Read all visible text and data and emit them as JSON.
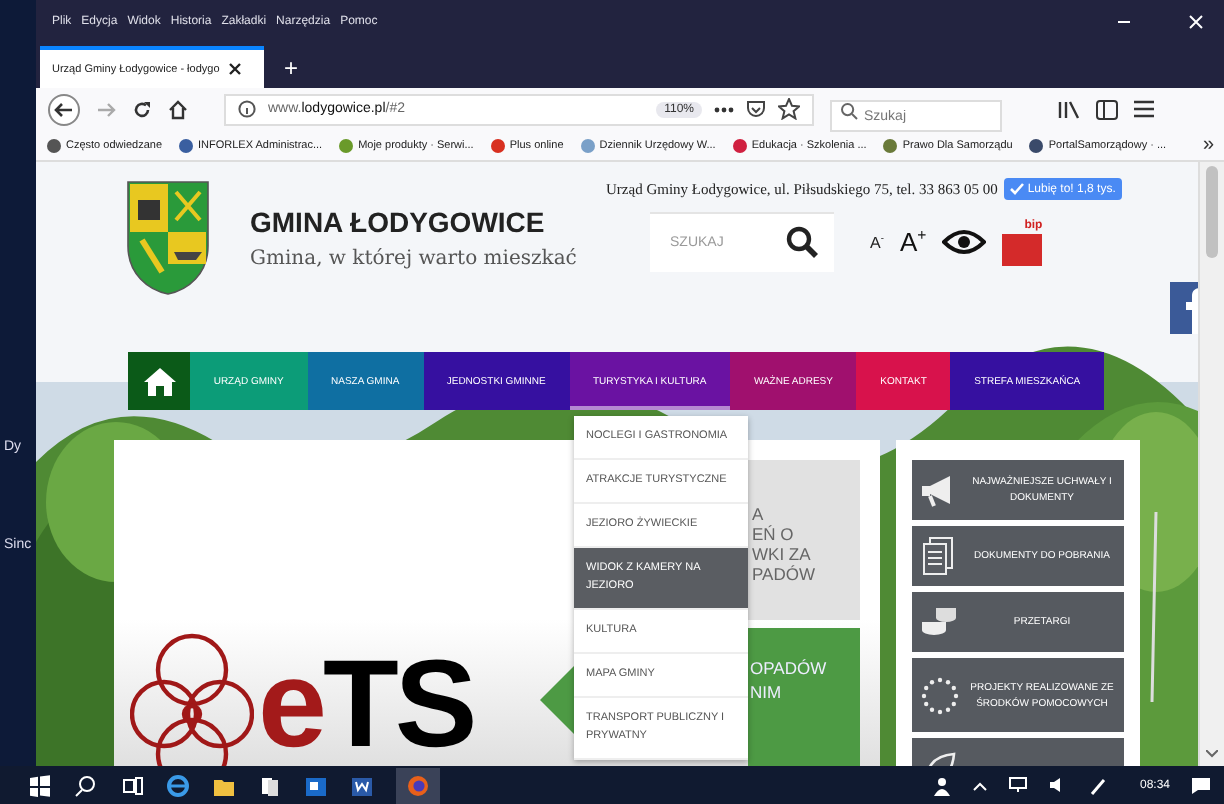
{
  "desktop": {
    "icon_labels": [
      "Dy",
      "Sinc"
    ]
  },
  "browser": {
    "menu_bar": [
      "Plik",
      "Edycja",
      "Widok",
      "Historia",
      "Zakładki",
      "Narzędzia",
      "Pomoc"
    ],
    "tabs": [
      {
        "label": "Urząd Gminy Łodygowice - łodygo",
        "selected": true
      }
    ],
    "new_tab": "+",
    "address": "www.**lodygowice.pl**/#2",
    "zoom": "110%",
    "search": {
      "placeholder": "Szukaj"
    },
    "bookmarks": [
      "Często odwiedzane",
      "INFORLEX Administrac...",
      "Moje produkty · Serwi...",
      "Plus online",
      "Dziennik Urzędowy W...",
      "Edukacja · Szkolenia ...",
      "Prawo Dla Samorządu",
      "PortalSamorządowy · ..."
    ],
    "bookmarks_more": "»"
  },
  "site": {
    "title": "GMINA ŁODYGOWICE",
    "tagline": "Gmina, w której warto mieszkać",
    "contact": "Urząd Gminy Łodygowice, ul. Piłsudskiego 75, tel. 33 863 05 00",
    "like_button": "Lubię to! 1,8 tys.",
    "search": {
      "placeholder": "SZUKAJ"
    },
    "font_smaller": "A$^{-}$",
    "font_larger": "A$^{+}$",
    "bip": "bip",
    "nav": [
      {
        "label": "URZĄD GMINY",
        "color": "#0c9c78",
        "selected": false
      },
      {
        "label": "NASZA GMINA",
        "color": "#0f6fa2",
        "selected": false
      },
      {
        "label": "JEDNOSTKI GMINNE",
        "color": "#3610a0",
        "selected": false
      },
      {
        "label": "TURYSTYKA I KULTURA",
        "color": "#6a12a2",
        "selected": true
      },
      {
        "label": "WAŻNE ADRESY",
        "color": "#a0106e",
        "selected": false
      },
      {
        "label": "KONTAKT",
        "color": "#d8124c",
        "selected": false
      },
      {
        "label": "STREFA MIESZKAŃCA",
        "color": "#3610a0",
        "selected": false
      }
    ],
    "dropdown": [
      {
        "label": "NOCLEGI I GASTRONOMIA",
        "selected": false
      },
      {
        "label": "ATRAKCJE TURYSTYCZNE",
        "selected": false
      },
      {
        "label": "JEZIORO ŻYWIECKIE",
        "selected": false
      },
      {
        "label": "WIDOK Z KAMERY NA JEZIORO",
        "selected": true
      },
      {
        "label": "KULTURA",
        "selected": false
      },
      {
        "label": "MAPA GMINY",
        "selected": false
      },
      {
        "label": "TRANSPORT PUBLICZNY I PRYWATNY",
        "selected": false
      }
    ],
    "banner_logo": "eTS",
    "grey_tile_lines": [
      "A",
      "EŃ O",
      "WKI ZA",
      "PADÓW"
    ],
    "green_tile_lines": [
      "OPADÓW",
      "NIM"
    ],
    "side_buttons": [
      {
        "label": "NAJWAŻNIEJSZE UCHWAŁY I DOKUMENTY",
        "kind": "megaphone"
      },
      {
        "label": "DOKUMENTY DO POBRANIA",
        "kind": "documents"
      },
      {
        "label": "PRZETARGI",
        "kind": "coins"
      },
      {
        "label": "PROJEKTY REALIZOWANE ZE ŚRODKÓW POMOCOWYCH",
        "kind": "stars"
      },
      {
        "kind": "leaf"
      }
    ]
  },
  "taskbar": {
    "time": "08:34"
  }
}
